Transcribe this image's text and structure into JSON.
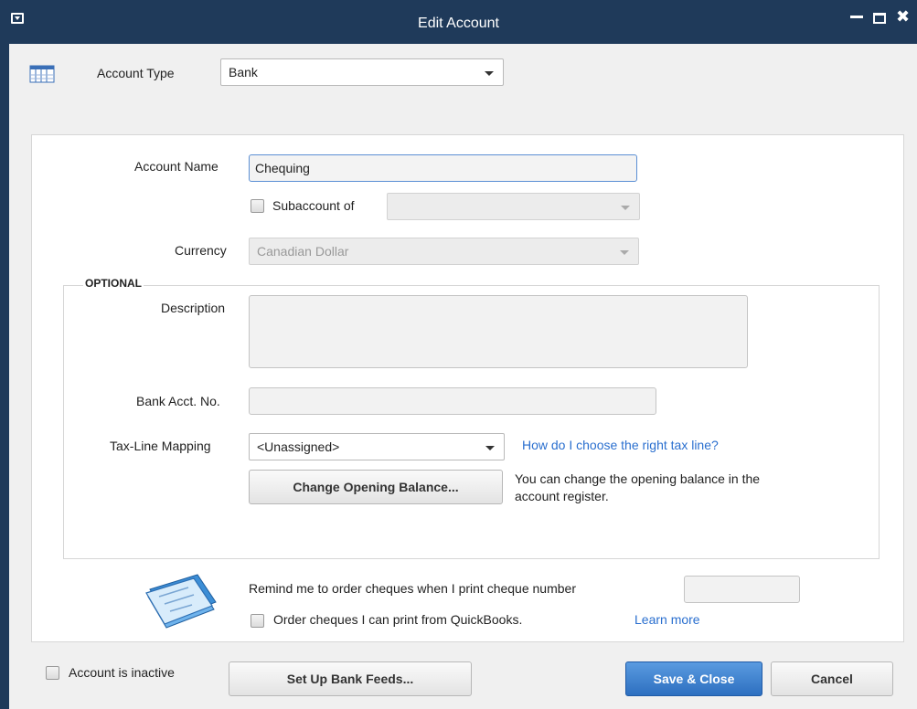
{
  "window": {
    "title": "Edit Account"
  },
  "account_type": {
    "label": "Account Type",
    "value": "Bank"
  },
  "account_name": {
    "label": "Account Name",
    "value": "Chequing"
  },
  "subaccount": {
    "label": "Subaccount of",
    "value": ""
  },
  "currency": {
    "label": "Currency",
    "value": "Canadian Dollar"
  },
  "optional": {
    "heading": "OPTIONAL",
    "description_label": "Description",
    "description_value": "",
    "bank_acct_label": "Bank Acct. No.",
    "bank_acct_value": "",
    "tax_line_label": "Tax-Line Mapping",
    "tax_line_value": "<Unassigned>",
    "tax_line_help": "How do I choose the right tax line?",
    "change_balance_button": "Change Opening Balance...",
    "change_balance_note_1": "You can change the opening balance in the",
    "change_balance_note_2": "account register."
  },
  "cheques": {
    "remind_label": "Remind me to order cheques when I print cheque number",
    "remind_value": "",
    "order_label": "Order cheques I can print from QuickBooks.",
    "learn_more": "Learn more"
  },
  "footer": {
    "inactive_label": "Account is inactive",
    "bank_feeds_button": "Set Up Bank Feeds...",
    "save_close_button": "Save & Close",
    "cancel_button": "Cancel"
  },
  "colors": {
    "titlebar": "#1f3a5a",
    "accent": "#2d6fc0",
    "link": "#2a6fcf"
  }
}
